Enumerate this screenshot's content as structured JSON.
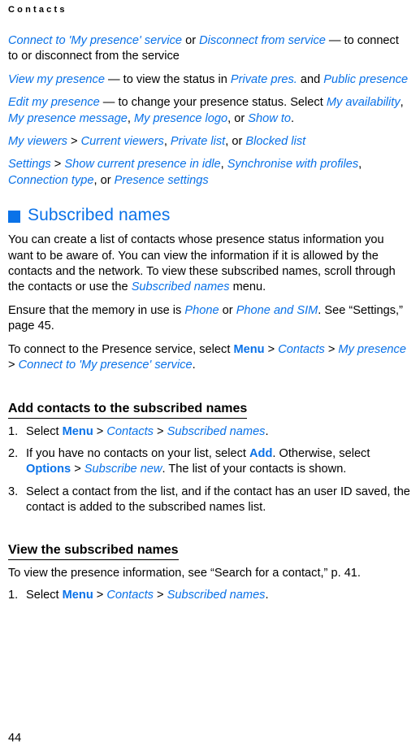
{
  "header": {
    "running_head": "Contacts"
  },
  "folio": {
    "page_number": "44"
  },
  "colors": {
    "link_blue": "#0a72e8",
    "text_black": "#000000",
    "page_background": "#ffffff"
  },
  "paragraphs": {
    "p1": {
      "r1": "Connect to 'My presence' service",
      "r2": " or ",
      "r3": "Disconnect from service",
      "r4": " — to connect to or disconnect from the service"
    },
    "p2": {
      "r1": "View my presence",
      "r2": " — to view the status in ",
      "r3": "Private pres.",
      "r4": " and ",
      "r5": "Public presence"
    },
    "p3": {
      "r1": "Edit my presence",
      "r2": " — to change your presence status. Select ",
      "r3": "My availability",
      "r4": ", ",
      "r5": "My presence message",
      "r6": ", ",
      "r7": "My presence logo",
      "r8": ", or ",
      "r9": "Show to",
      "r10": "."
    },
    "p4": {
      "r1": "My viewers",
      "r2": " > ",
      "r3": "Current viewers",
      "r4": ", ",
      "r5": "Private list",
      "r6": ", or ",
      "r7": "Blocked list"
    },
    "p5": {
      "r1": "Settings",
      "r2": " > ",
      "r3": "Show current presence in idle",
      "r4": ", ",
      "r5": "Synchronise with profiles",
      "r6": ", ",
      "r7": "Connection type",
      "r8": ", or ",
      "r9": "Presence settings"
    },
    "p6": {
      "r1": "You can create a list of contacts whose presence status information you want to be aware of. You can view the information if it is allowed by the contacts and the network. To view these subscribed names, scroll through the contacts or use the ",
      "r2": "Subscribed names",
      "r3": " menu."
    },
    "p7": {
      "r1": "Ensure that the memory in use is ",
      "r2": "Phone",
      "r3": " or ",
      "r4": "Phone and SIM",
      "r5": ". See “Settings,” page 45."
    },
    "p8": {
      "r1": "To connect to the Presence service, select ",
      "r2": "Menu",
      "r3": " > ",
      "r4": "Contacts",
      "r5": " > ",
      "r6": "My presence",
      "r7": " > ",
      "r8": "Connect to 'My presence' service",
      "r9": "."
    },
    "p10": {
      "r1": "To view the presence information, see “Search for a contact,” p. 41."
    }
  },
  "headings": {
    "section_title": "Subscribed names",
    "sub1": "Add contacts to the subscribed names",
    "sub2": "View the subscribed names"
  },
  "list1": {
    "items": [
      {
        "num": "1.",
        "r1": "Select ",
        "r2": "Menu",
        "r3": " > ",
        "r4": "Contacts",
        "r5": " > ",
        "r6": "Subscribed names",
        "r7": "."
      },
      {
        "num": "2.",
        "r1": "If you have no contacts on your list, select ",
        "r2": "Add",
        "r3": ". Otherwise, select ",
        "r4": "Options",
        "r5": " > ",
        "r6": "Subscribe new",
        "r7": ". The list of your contacts is shown."
      },
      {
        "num": "3.",
        "r1": "Select a contact from the list, and if the contact has an user ID saved, the contact is added to the subscribed names list.",
        "r2": "",
        "r3": "",
        "r4": "",
        "r5": "",
        "r6": "",
        "r7": ""
      }
    ]
  },
  "list2": {
    "items": [
      {
        "num": "1.",
        "r1": "Select ",
        "r2": "Menu",
        "r3": " > ",
        "r4": "Contacts",
        "r5": " > ",
        "r6": "Subscribed names",
        "r7": "."
      }
    ]
  }
}
